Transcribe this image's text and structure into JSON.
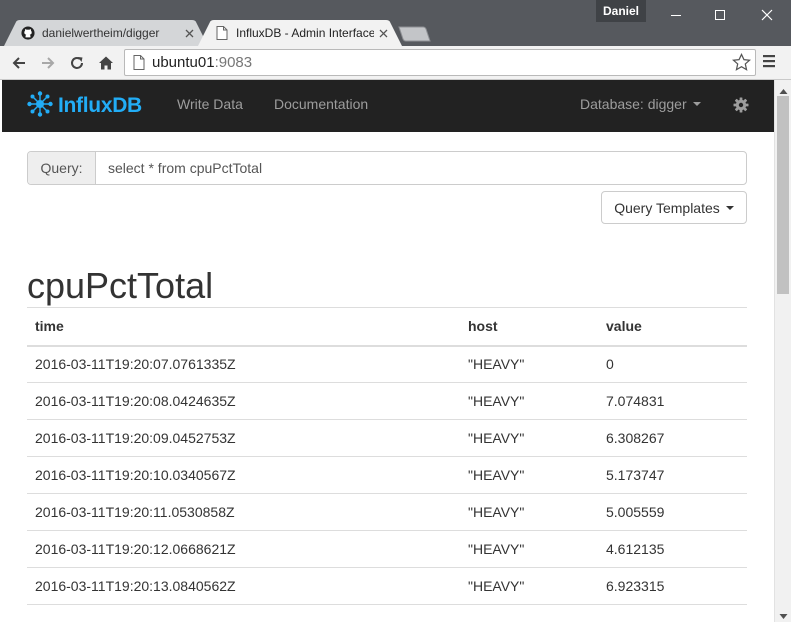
{
  "window": {
    "user_name": "Daniel",
    "controls": {
      "minimize": "minimize-icon",
      "maximize": "maximize-icon",
      "close": "close-icon"
    }
  },
  "tabs": [
    {
      "title": "danielwertheim/digger",
      "icon": "github-icon",
      "active": false
    },
    {
      "title": "InfluxDB - Admin Interface",
      "icon": "page-icon",
      "active": true
    }
  ],
  "toolbar": {
    "url_host": "ubuntu01",
    "url_port": ":9083",
    "buttons": [
      "back-icon",
      "forward-icon",
      "reload-icon",
      "home-icon",
      "bookmark-star-icon",
      "menu-icon"
    ]
  },
  "navbar": {
    "brand": "InfluxDB",
    "links": [
      "Write Data",
      "Documentation"
    ],
    "database_label": "Database: digger",
    "settings_icon": "gear-icon",
    "brand_color": "#22adf6"
  },
  "query": {
    "label": "Query:",
    "value": "select * from cpuPctTotal",
    "templates_label": "Query Templates"
  },
  "results": {
    "series_name": "cpuPctTotal",
    "columns": [
      "time",
      "host",
      "value"
    ],
    "rows": [
      [
        "2016-03-11T19:20:07.0761335Z",
        "\"HEAVY\"",
        "0"
      ],
      [
        "2016-03-11T19:20:08.0424635Z",
        "\"HEAVY\"",
        "7.074831"
      ],
      [
        "2016-03-11T19:20:09.0452753Z",
        "\"HEAVY\"",
        "6.308267"
      ],
      [
        "2016-03-11T19:20:10.0340567Z",
        "\"HEAVY\"",
        "5.173747"
      ],
      [
        "2016-03-11T19:20:11.0530858Z",
        "\"HEAVY\"",
        "5.005559"
      ],
      [
        "2016-03-11T19:20:12.0668621Z",
        "\"HEAVY\"",
        "4.612135"
      ],
      [
        "2016-03-11T19:20:13.0840562Z",
        "\"HEAVY\"",
        "6.923315"
      ]
    ]
  }
}
